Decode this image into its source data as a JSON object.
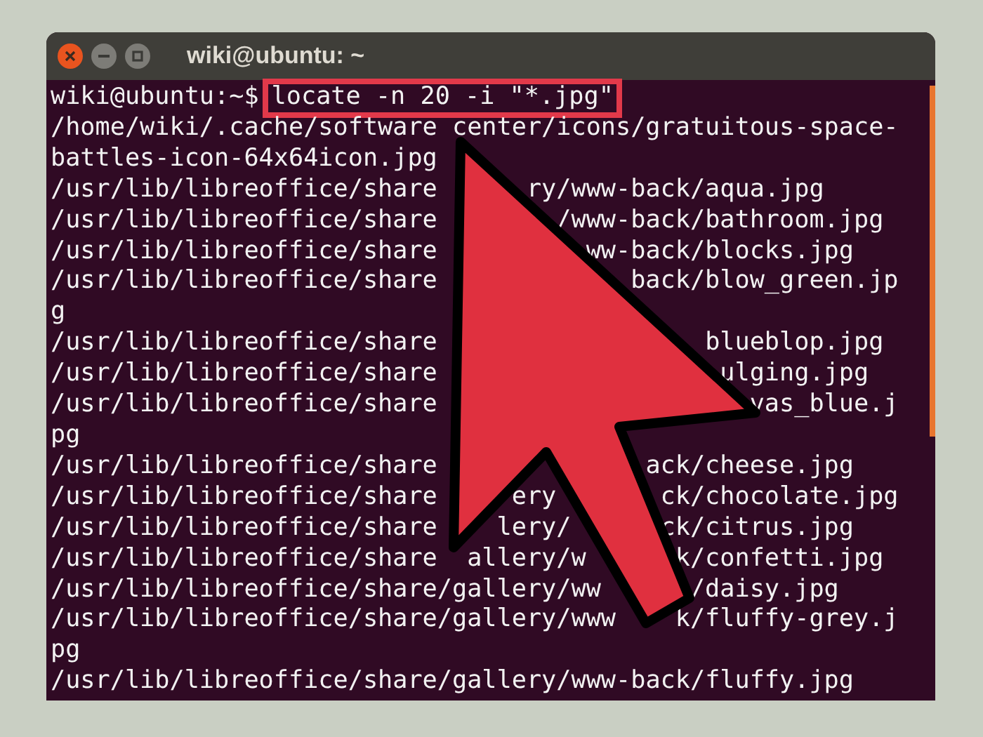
{
  "window": {
    "title": "wiki@ubuntu: ~"
  },
  "prompt": "wiki@ubuntu:~$",
  "command": {
    "text": "locate -n 20 -i \"*.jpg\"",
    "highlighted": true
  },
  "output_lines": [
    {
      "segments": [
        "/home/wiki/.cache/software",
        "center/icons/gratuitous-space-"
      ]
    },
    {
      "segments": [
        "battles-icon-64x64icon.jpg"
      ]
    },
    {
      "segments": [
        "/usr/lib/libreoffice/share",
        "ry/www-back/aqua.jpg"
      ]
    },
    {
      "segments": [
        "/usr/lib/libreoffice/share",
        "/www-back/bathroom.jpg"
      ]
    },
    {
      "segments": [
        "/usr/lib/libreoffice/share",
        "ww-back/blocks.jpg"
      ]
    },
    {
      "segments": [
        "/usr/lib/libreoffice/share",
        "back/blow_green.jp"
      ]
    },
    {
      "segments": [
        "g"
      ]
    },
    {
      "segments": [
        "/usr/lib/libreoffice/share",
        "blueblop.jpg"
      ]
    },
    {
      "segments": [
        "/usr/lib/libreoffice/share",
        "ulging.jpg"
      ]
    },
    {
      "segments": [
        "/usr/lib/libreoffice/share",
        "vas_blue.j"
      ]
    },
    {
      "segments": [
        "pg"
      ]
    },
    {
      "segments": [
        "/usr/lib/libreoffice/share",
        "ack/cheese.jpg"
      ]
    },
    {
      "segments": [
        "/usr/lib/libreoffice/share",
        "ery",
        "ck/chocolate.jpg"
      ]
    },
    {
      "segments": [
        "/usr/lib/libreoffice/share",
        "lery/",
        "ck/citrus.jpg"
      ]
    },
    {
      "segments": [
        "/usr/lib/libreoffice/share",
        "allery/w",
        "k/confetti.jpg"
      ]
    },
    {
      "segments": [
        "/usr/lib/libreoffice/share/gallery/ww",
        "/daisy.jpg"
      ]
    },
    {
      "segments": [
        "/usr/lib/libreoffice/share/gallery/www",
        "k/fluffy-grey.j"
      ]
    },
    {
      "segments": [
        "pg"
      ]
    },
    {
      "segments": [
        "/usr/lib/libreoffice/share/gallery/www-back/fluffy.jpg"
      ]
    }
  ]
}
